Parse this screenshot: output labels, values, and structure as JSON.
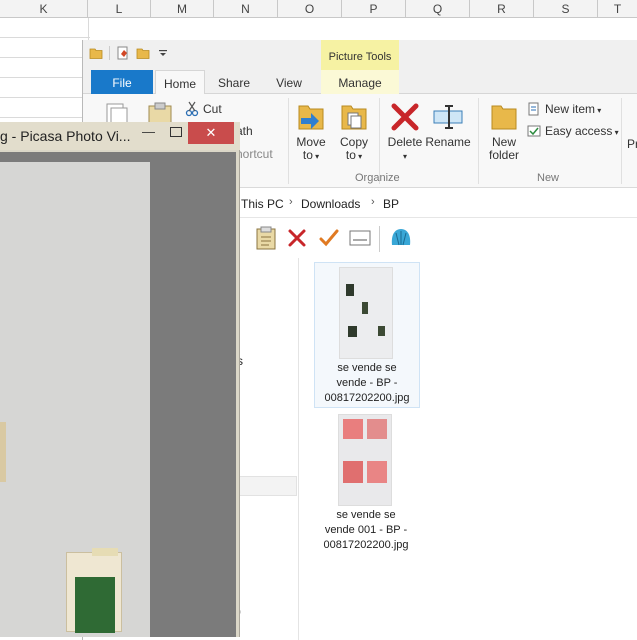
{
  "excel": {
    "columns": [
      "K",
      "L",
      "M",
      "N",
      "O",
      "P",
      "Q",
      "R",
      "S",
      "T"
    ]
  },
  "explorer": {
    "picture_tools_label": "Picture Tools",
    "tabs": {
      "file": "File",
      "home": "Home",
      "share": "Share",
      "view": "View",
      "manage": "Manage"
    },
    "ribbon": {
      "cut": "Cut",
      "copy_path": "ath",
      "paste_shortcut": "hortcut",
      "move_to": "Move",
      "move_to_2": "to",
      "copy_to": "Copy",
      "copy_to_2": "to",
      "delete": "Delete",
      "rename": "Rename",
      "new_folder": "New",
      "new_folder_2": "folder",
      "new_item": "New item",
      "easy_access": "Easy access",
      "properties_partial": "Pr",
      "group_organize": "Organize",
      "group_new": "New"
    },
    "breadcrumb": [
      "This PC",
      "Downloads",
      "BP"
    ],
    "nav_partial_s": "s",
    "nav_partial_paren": ")",
    "files": [
      {
        "name_line1": "se vende se",
        "name_line2": "vende - BP -",
        "name_line3": "00817202200.jpg"
      },
      {
        "name_line1": "se vende se",
        "name_line2": "vende 001 - BP -",
        "name_line3": "00817202200.jpg"
      }
    ]
  },
  "picasa": {
    "title": "g - Picasa Photo Vi...",
    "minimize": "—",
    "close": "✕"
  },
  "colors": {
    "file_tab": "#1979ca",
    "picture_tools": "#f6f2a3",
    "close_button": "#c94c4c",
    "picasa_frame": "#dbd7c8"
  }
}
